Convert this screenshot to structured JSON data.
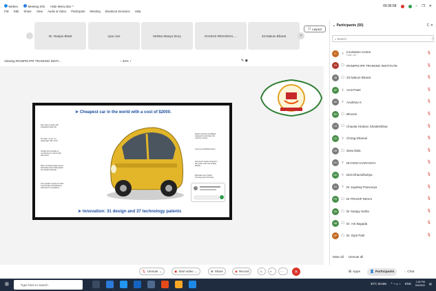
{
  "titlebar": {
    "app_items": [
      "Webex",
      "Meeting Info",
      "Hide Menu Bar ^"
    ],
    "menu": [
      "File",
      "Edit",
      "Share",
      "View",
      "Audio & Video",
      "Participant",
      "Meeting",
      "Breakout Sessions",
      "Help"
    ],
    "time": "09:36:58"
  },
  "tiles": [
    "Dr. Ranjan Bhatt",
    "ryan rore",
    "Mohtar Manya Story",
    "RANCHI REGIONAL ...",
    "33 Nakum Bharat"
  ],
  "layout_label": "Layout",
  "viewing": "Viewing RGNIPM IPR TRAINING INSTI...",
  "zoom": "44%",
  "slide": {
    "title": "➤ Cheapest car in the world with a cost of $2000.",
    "footer": "➤ Innovation: 31 design and 37 technology patents",
    "left_callouts": [
      "New type of seats with integrated head rest",
      "No radio, no a/c, no passenger side mirror",
      "Similar door handles & mechanisms to left & right side doors",
      "Rear mounted engine layout eliminates drive shaft (space and weight savings)",
      "Two cylinder engine for lower cost & better fuel efficiency with Euro III compliance"
    ],
    "right_callouts": [
      "Plastic panels immediately designed to eliminate the need for screws",
      "Just one windshield wiper",
      "Instrument cluster located in the center with only analog display",
      "Eliminate use of Hard trimming and roof lining",
      "Aluminium ring"
    ]
  },
  "panel": {
    "title": "Participants (50)",
    "search_placeholder": "Search",
    "participants": [
      {
        "initials": "IC",
        "name": "Incubation Centre",
        "sub": "Host, me",
        "color": "#c46a22"
      },
      {
        "initials": "RI",
        "name": "RGNIPM IPR TRAINING INSTITUTE",
        "sub": "",
        "color": "#b03a2e"
      },
      {
        "initials": "3B",
        "name": "33 Nakum Bharat",
        "sub": "",
        "color": "#7a7a7a"
      },
      {
        "initials": "AP",
        "name": "Amit Patel",
        "sub": "",
        "color": "#4a8f4a"
      },
      {
        "initials": "AK",
        "name": "Anubhav K",
        "sub": "",
        "color": "#7a7a7a"
      },
      {
        "initials": "BH",
        "name": "Bhoomi",
        "sub": "",
        "color": "#4a8f4a"
      },
      {
        "initials": "CS",
        "name": "Chavda Hirabon Shaileshbhai",
        "sub": "",
        "color": "#7a7a7a"
      },
      {
        "initials": "CD",
        "name": "Chirag Dhamal",
        "sub": "",
        "color": "#4a8f4a"
      },
      {
        "initials": "DB",
        "name": "deep tilala",
        "sub": "",
        "color": "#7a7a7a"
      },
      {
        "initials": "DH",
        "name": "DHYESH HARANIYA",
        "sub": "",
        "color": "#7a7a7a"
      },
      {
        "initials": "DD",
        "name": "Dixit Dharsdhukiya",
        "sub": "",
        "color": "#4a8f4a"
      },
      {
        "initials": "DJ",
        "name": "Dr Jaydeep Pansuriya",
        "sub": "",
        "color": "#7a7a7a"
      },
      {
        "initials": "PD",
        "name": "Dr PRADIP DESAI",
        "sub": "",
        "color": "#4a8f4a"
      },
      {
        "initials": "SS",
        "name": "Dr Sanjay Sutha",
        "sub": "",
        "color": "#4a8f4a"
      },
      {
        "initials": "AB",
        "name": "Dr. Arti Bagada",
        "sub": "",
        "color": "#4a8f4a"
      },
      {
        "initials": "DP",
        "name": "Dr. Dipti Patil",
        "sub": "",
        "color": "#c46a22"
      }
    ],
    "mute_all": "Mute all",
    "unmute_all": "Unmute all"
  },
  "toolbar": {
    "unmute": "Unmute",
    "start_video": "Start video",
    "share": "Share",
    "record": "Record",
    "apps": "Apps",
    "participants": "Participants",
    "chat": "Chat"
  },
  "taskbar": {
    "search_placeholder": "Type here to search",
    "weather": "33°C Smoke",
    "lang": "ENG",
    "time": "1:52 PM",
    "date": "5/9/2022"
  }
}
